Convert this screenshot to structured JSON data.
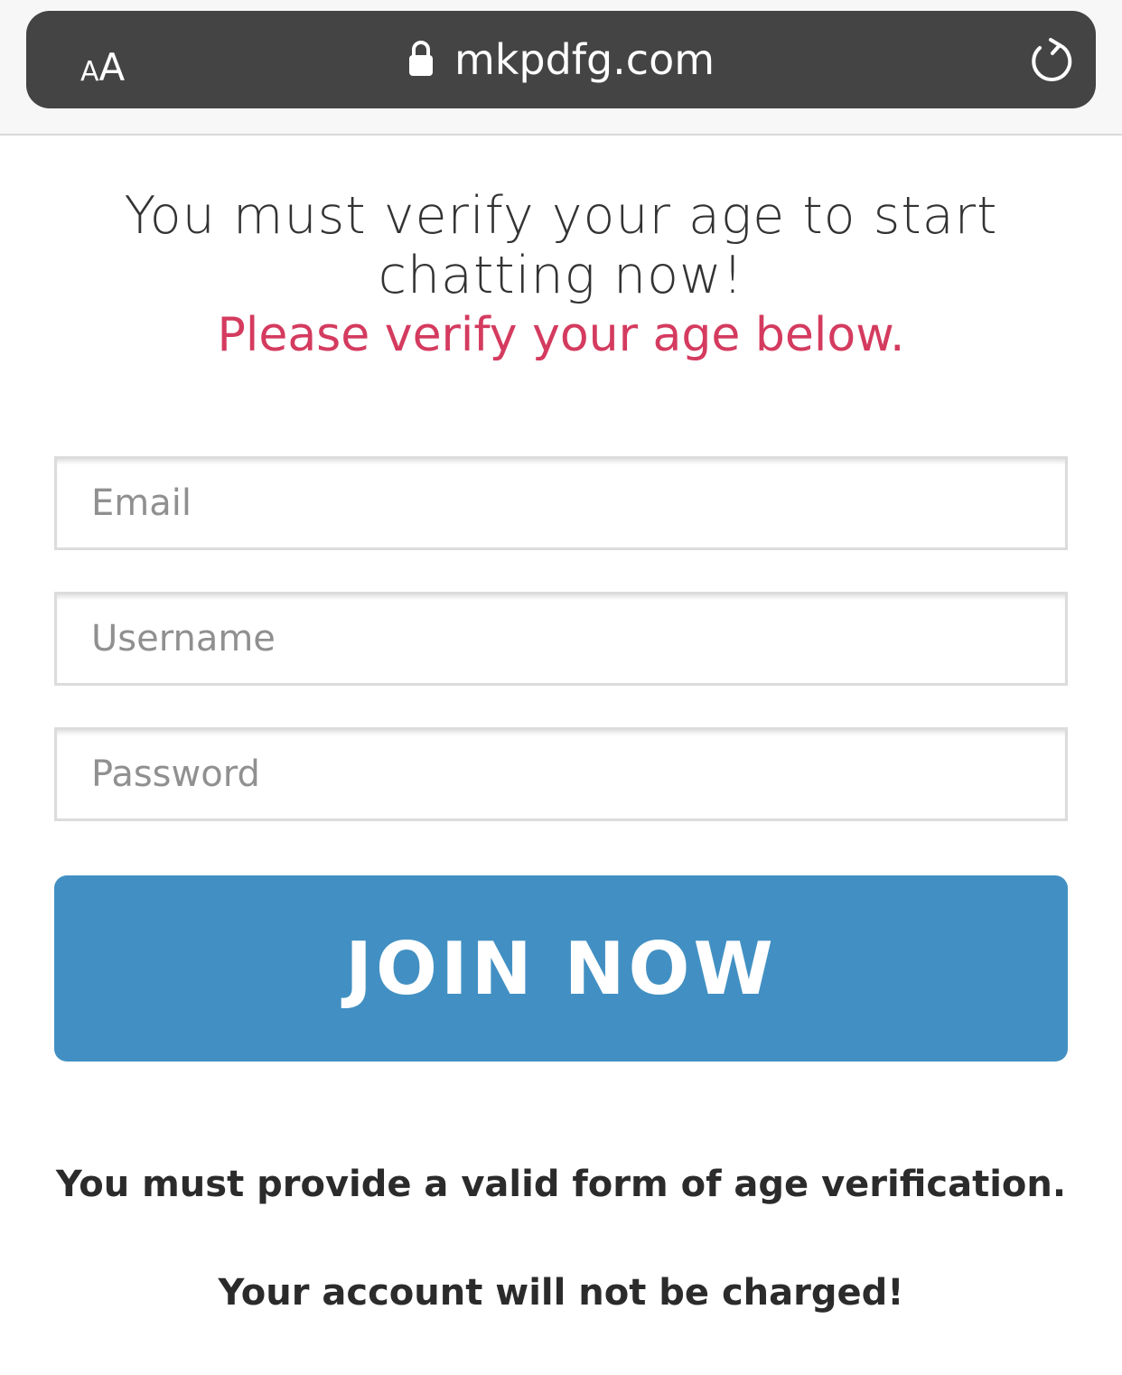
{
  "browser": {
    "text_size_label_small": "A",
    "text_size_label_large": "A",
    "url": "mkpdfg.com",
    "lock_icon": "lock-icon",
    "reload_icon": "reload-icon"
  },
  "page": {
    "headline_line1": "You must verify your age to start",
    "headline_line2": "chatting now!",
    "subheadline": "Please verify your age below.",
    "email_placeholder": "Email",
    "username_placeholder": "Username",
    "password_placeholder": "Password",
    "join_button_label": "JOIN NOW",
    "notice_1": "You must provide a valid form of age verification.",
    "notice_2": "Your account will not be charged!"
  },
  "colors": {
    "address_bar": "#444444",
    "subheadline": "#d43b5f",
    "button": "#4290c3"
  }
}
